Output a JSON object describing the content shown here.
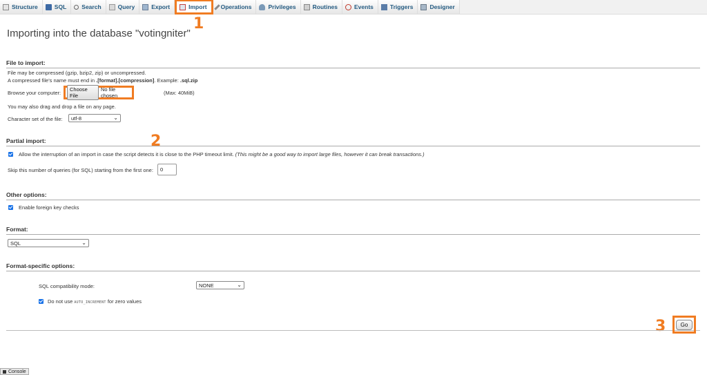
{
  "tabs": [
    {
      "label": "Structure",
      "icon": "structure-icon"
    },
    {
      "label": "SQL",
      "icon": "sql-icon"
    },
    {
      "label": "Search",
      "icon": "search-icon"
    },
    {
      "label": "Query",
      "icon": "query-icon"
    },
    {
      "label": "Export",
      "icon": "export-icon"
    },
    {
      "label": "Import",
      "icon": "import-icon"
    },
    {
      "label": "Operations",
      "icon": "operations-icon"
    },
    {
      "label": "Privileges",
      "icon": "privileges-icon"
    },
    {
      "label": "Routines",
      "icon": "routines-icon"
    },
    {
      "label": "Events",
      "icon": "events-icon"
    },
    {
      "label": "Triggers",
      "icon": "triggers-icon"
    },
    {
      "label": "Designer",
      "icon": "designer-icon"
    }
  ],
  "annotations": {
    "one": "1",
    "two": "2",
    "three": "3",
    "color": "#f07c22"
  },
  "page_title": "Importing into the database \"votingniter\"",
  "file_section": {
    "heading": "File to import:",
    "line1": "File may be compressed (gzip, bzip2, zip) or uncompressed.",
    "line2_prefix": "A compressed file's name must end in ",
    "line2_format": ".[format].[compression]",
    "line2_example": ". Example: ",
    "line2_example_file": ".sql.zip",
    "browse_label": "Browse your computer:",
    "choose_button": "Choose File",
    "no_file": "No file chosen",
    "max_size": "(Max: 40MiB)",
    "drag_note": "You may also drag and drop a file on any page.",
    "charset_label": "Character set of the file:",
    "charset_value": "utf-8"
  },
  "partial_section": {
    "heading": "Partial import:",
    "allow_interrupt": "Allow the interruption of an import in case the script detects it is close to the PHP timeout limit.",
    "allow_interrupt_note": "(This might be a good way to import large files, however it can break transactions.)",
    "skip_label": "Skip this number of queries (for SQL) starting from the first one:",
    "skip_value": "0"
  },
  "other_section": {
    "heading": "Other options:",
    "foreign_keys": "Enable foreign key checks"
  },
  "format_section": {
    "heading": "Format:",
    "format_value": "SQL"
  },
  "format_specific": {
    "heading": "Format-specific options:",
    "compat_label": "SQL compatibility mode:",
    "compat_value": "NONE",
    "auto_inc_prefix": "Do not use",
    "auto_inc_keyword": "AUTO_INCREMENT",
    "auto_inc_suffix": "for zero values"
  },
  "go_button": "Go",
  "console_label": "Console"
}
